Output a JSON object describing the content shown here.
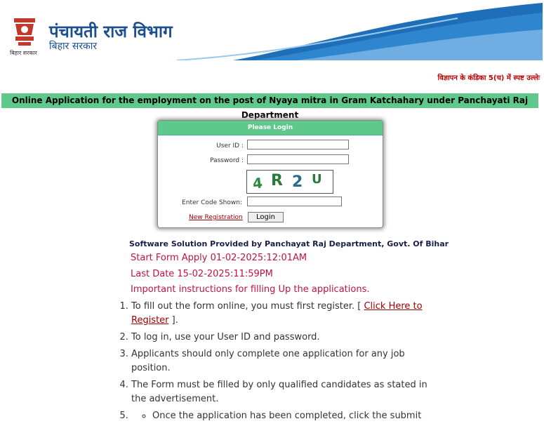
{
  "header": {
    "title": "पंचायती राज विभाग",
    "subtitle": "बिहार सरकार",
    "emblem_caption": "बिहार सरकार",
    "emblem_icon": "bihar-emblem-icon",
    "wave_colors": [
      "#1f6fb8",
      "#7fb7e6"
    ]
  },
  "notice": "विज्ञापन के कंडिका 5(च) में स्पष्ट उल्लेः",
  "banner": "Online Application for the employment on the post of Nyaya mitra in Gram Katchahary under Panchayati Raj Department",
  "login": {
    "title": "Please Login",
    "user_id_label": "User ID :",
    "password_label": "Password :",
    "captcha_chars": [
      "4",
      "R",
      "2",
      "U"
    ],
    "code_label": "Enter Code Shown:",
    "new_registration": "New Registration",
    "login_button": "Login"
  },
  "software_solution": "Software Solution Provided by Panchayat Raj Department, Govt. Of Bihar",
  "start_form": "Start Form Apply 01-02-2025:12:01AM",
  "last_date": "Last Date 15-02-2025:11:59PM",
  "important": "Important instructions for filling Up the applications.",
  "instructions": {
    "item1_prefix": "To fill out the form online, you must first register. [ ",
    "item1_link": "Click Here to Register",
    "item1_suffix": " ].",
    "item2": "To log in, use your User ID and password.",
    "item3": "Applicants should only complete one application for any job position.",
    "item4": "The Form must be filled by only qualified candidates as stated in the advertisement.",
    "item5": "",
    "item5_sub": "Once the application has been completed, click the submit"
  },
  "colors": {
    "banner_green": "#5ec98a",
    "accent_red": "#c0143c",
    "link_red": "#a00000"
  }
}
